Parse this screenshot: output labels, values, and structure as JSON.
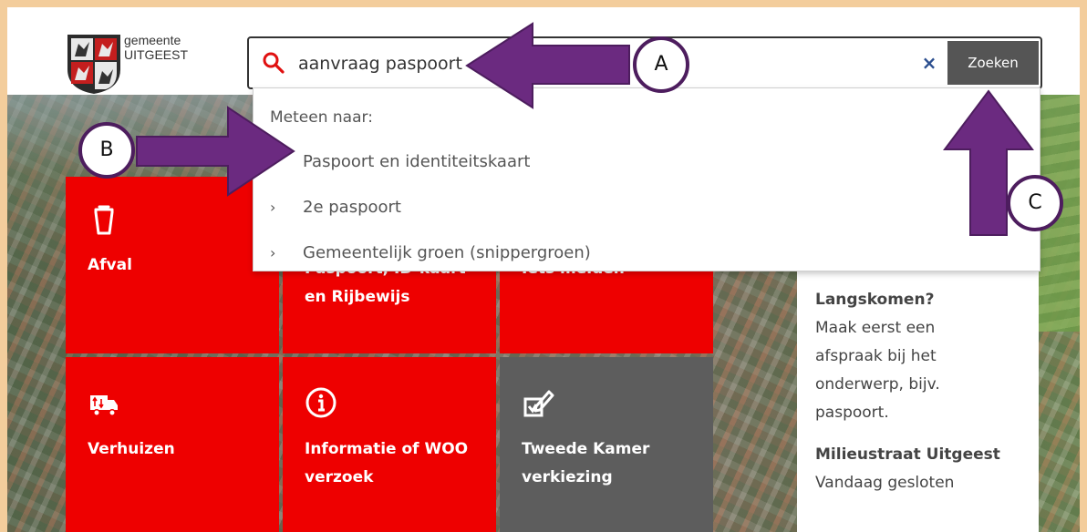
{
  "header": {
    "logo_line1": "gemeente",
    "logo_line2": "UITGEEST"
  },
  "search": {
    "icon": "search-icon",
    "value": "aanvraag paspoort",
    "clear_symbol": "×",
    "button_label": "Zoeken"
  },
  "dropdown": {
    "heading": "Meteen naar:",
    "items": [
      {
        "label": "Paspoort en identiteitskaart",
        "chevron": false
      },
      {
        "label": "2e paspoort",
        "chevron": true
      },
      {
        "label": "Gemeentelijk groen (snippergroen)",
        "chevron": true
      }
    ]
  },
  "tiles": [
    {
      "label": "Afval",
      "icon": "trash-bin-icon",
      "color": "#ee0000"
    },
    {
      "label_line1": "Paspoort, ID-kaart",
      "label_line2": "en Rijbewijs",
      "color": "#ee0000"
    },
    {
      "label": "Iets melden",
      "color": "#ee0000"
    },
    {
      "label": "Verhuizen",
      "icon": "moving-truck-icon",
      "color": "#ee0000"
    },
    {
      "label_line1": "Informatie of WOO",
      "label_line2": "verzoek",
      "icon": "info-circle-icon",
      "color": "#ee0000"
    },
    {
      "label_line1": "Tweede Kamer",
      "label_line2": "verkiezing",
      "icon": "ballot-check-icon",
      "color": "#5d5d5d"
    }
  ],
  "info": {
    "visit_title": "Langskomen?",
    "visit_lines": [
      "Maak eerst een",
      "afspraak bij het",
      "onderwerp, bijv.",
      "paspoort."
    ],
    "milieustraat_title": "Milieustraat Uitgeest",
    "milieustraat_status": "Vandaag gesloten"
  },
  "annotations": {
    "a": "A",
    "b": "B",
    "c": "C",
    "arrow_color": "#6b2a80"
  }
}
